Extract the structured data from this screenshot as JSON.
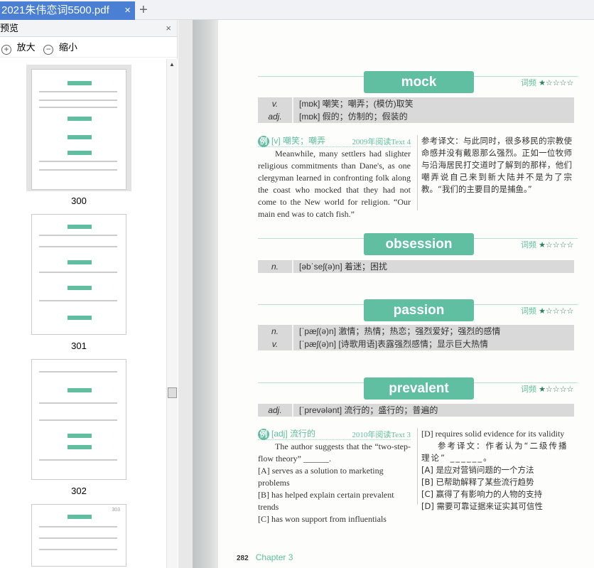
{
  "tab": {
    "title": "2021朱伟恋词5500.pdf",
    "close": "×",
    "new": "+"
  },
  "sidebar": {
    "title": "预览",
    "close": "×",
    "zoom_in": "放大",
    "zoom_out": "缩小",
    "thumbs": [
      {
        "page": "300",
        "selected": true
      },
      {
        "page": "301"
      },
      {
        "page": "302"
      },
      {
        "page": "303"
      }
    ]
  },
  "page": {
    "freq_label": "词频",
    "stars": "★☆☆☆☆",
    "entries": [
      {
        "word": "mock",
        "defs": [
          {
            "pos": "v.",
            "def": "[mɒk] 嘲笑；嘲弄；(模仿)取笑"
          },
          {
            "pos": "adj.",
            "def": "[mɒk] 假的；仿制的；假装的"
          }
        ]
      },
      {
        "word": "obsession",
        "defs": [
          {
            "pos": "n.",
            "def": "[əbˈseʃ(ə)n] 着迷；困扰"
          }
        ]
      },
      {
        "word": "passion",
        "defs": [
          {
            "pos": "n.",
            "def": "[ˈpæʃ(ə)n] 激情；热情；热恋；强烈爱好；强烈的感情"
          },
          {
            "pos": "v.",
            "def": "[ˈpæʃ(ə)n] [诗歌用语]表露强烈感情；显示巨大热情"
          }
        ]
      },
      {
        "word": "prevalent",
        "defs": [
          {
            "pos": "adj.",
            "def": "[ˈprevələnt] 流行的；盛行的；普遍的"
          }
        ]
      }
    ],
    "examples": [
      {
        "icon": "例",
        "sense": "[v] 嘲笑；嘲弄",
        "source": "2009年阅读Text 4",
        "en": "Meanwhile, many settlers had slighter religious commitments than Dane's, as one clergyman learned in confronting folk along the coast who mocked that they had not come to the New world for religion. “Our main end was to catch fish.”",
        "zh": "参考译文：与此同时，很多移民的宗教使命感并没有戴恩那么强烈。正如一位牧师与沿海居民打交道时了解到的那样，他们嘲弄说自己来到新大陆并不是为了宗教。“我们的主要目的是捕鱼。”"
      },
      {
        "icon": "例",
        "sense": "[adj] 流行的",
        "source": "2010年阅读Text 3",
        "en": "The author suggests that the “two-step-flow theory” ______.",
        "options_en": [
          "[A] serves as a solution to marketing problems",
          "[B] has helped explain certain prevalent trends",
          "[C] has won support from influentials",
          "[D] requires solid evidence for its validity"
        ],
        "zh": "参考译文：作者认为“二级传播理论” ______。",
        "options_zh": [
          "[A] 是应对营销问题的一个方法",
          "[B] 已帮助解释了某些流行趋势",
          "[C] 赢得了有影响力的人物的支持",
          "[D] 需要可靠证据来证实其可信性"
        ]
      }
    ],
    "page_number": "282",
    "chapter": "Chapter 3"
  }
}
